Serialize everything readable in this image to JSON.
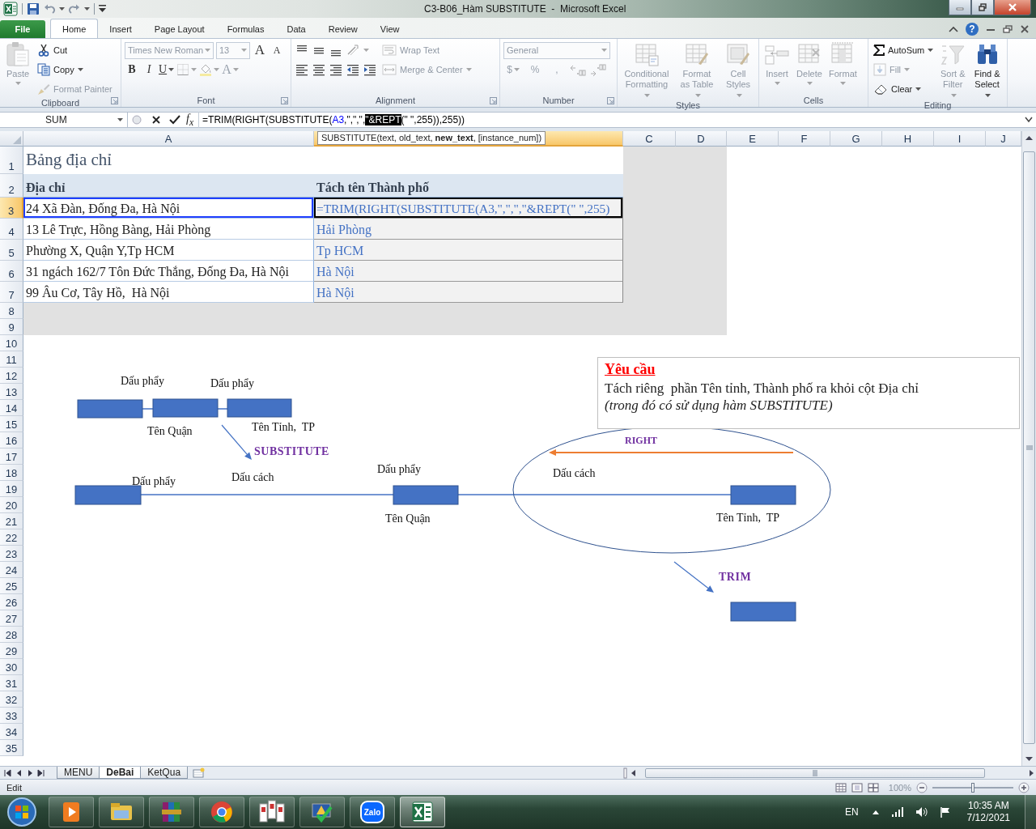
{
  "window": {
    "title": "C3-B06_Hàm SUBSTITUTE  -  Microsoft Excel"
  },
  "help": "?",
  "ribbon_tabs": [
    {
      "label": "File",
      "kind": "file",
      "selected": false
    },
    {
      "label": "Home",
      "kind": "tab",
      "selected": true
    },
    {
      "label": "Insert",
      "kind": "tab",
      "selected": false
    },
    {
      "label": "Page Layout",
      "kind": "tab",
      "selected": false
    },
    {
      "label": "Formulas",
      "kind": "tab",
      "selected": false
    },
    {
      "label": "Data",
      "kind": "tab",
      "selected": false
    },
    {
      "label": "Review",
      "kind": "tab",
      "selected": false
    },
    {
      "label": "View",
      "kind": "tab",
      "selected": false
    }
  ],
  "ribbon_groups": [
    {
      "label": "Clipboard",
      "launcher": true,
      "stacks": [
        {
          "lines": [
            {
              "items": [
                {
                  "kind": "large",
                  "lines": [
                    "Paste"
                  ],
                  "disabled": true,
                  "dropdown": true
                }
              ]
            }
          ]
        },
        {
          "lines": [
            {
              "items": [
                {
                  "kind": "small",
                  "label": "Cut",
                  "disabled": false,
                  "dropdown": false
                }
              ]
            },
            {
              "items": [
                {
                  "kind": "small",
                  "label": "Copy",
                  "disabled": false,
                  "dropdown": true
                }
              ]
            },
            {
              "items": [
                {
                  "kind": "small",
                  "label": "Format Painter",
                  "disabled": true,
                  "dropdown": false
                }
              ]
            }
          ]
        }
      ]
    },
    {
      "label": "Font",
      "launcher": true,
      "stacks": [
        {
          "lines": [
            {
              "items": [
                {
                  "kind": "field",
                  "value": "Times New Roman",
                  "disabled": true,
                  "dropdown": true
                },
                {
                  "kind": "field",
                  "value": "13",
                  "disabled": true,
                  "dropdown": true
                },
                {
                  "kind": "glyph",
                  "label": "A",
                  "disabled": false,
                  "dropdown": false
                },
                {
                  "kind": "glyph",
                  "label": "A",
                  "disabled": false,
                  "dropdown": false
                }
              ]
            },
            {
              "items": [
                {
                  "kind": "glyph",
                  "label": "B",
                  "disabled": false,
                  "dropdown": false
                },
                {
                  "kind": "glyph",
                  "label": "I",
                  "disabled": false,
                  "dropdown": false
                },
                {
                  "kind": "glyph",
                  "label": "U",
                  "disabled": false,
                  "dropdown": true
                },
                {
                  "kind": "icon",
                  "disabled": true,
                  "dropdown": true
                },
                {
                  "kind": "icon",
                  "disabled": true,
                  "dropdown": true
                },
                {
                  "kind": "glyph",
                  "label": "A",
                  "disabled": true,
                  "dropdown": true
                }
              ]
            }
          ]
        }
      ]
    },
    {
      "label": "Alignment",
      "launcher": true,
      "stacks": [
        {
          "lines": [
            {
              "items": [
                {
                  "kind": "icon",
                  "disabled": false,
                  "dropdown": false
                },
                {
                  "kind": "icon",
                  "disabled": false,
                  "dropdown": false
                },
                {
                  "kind": "icon",
                  "disabled": false,
                  "dropdown": false
                },
                {
                  "kind": "icon",
                  "disabled": true,
                  "dropdown": true
                }
              ]
            },
            {
              "items": [
                {
                  "kind": "icon",
                  "disabled": false,
                  "dropdown": false
                },
                {
                  "kind": "icon",
                  "disabled": false,
                  "dropdown": false
                },
                {
                  "kind": "icon",
                  "disabled": false,
                  "dropdown": false
                },
                {
                  "kind": "icon",
                  "disabled": false,
                  "dropdown": false
                },
                {
                  "kind": "icon",
                  "disabled": false,
                  "dropdown": false
                }
              ]
            }
          ]
        },
        {
          "lines": [
            {
              "items": [
                {
                  "kind": "small",
                  "label": "Wrap Text",
                  "disabled": true,
                  "dropdown": false
                }
              ]
            },
            {
              "items": [
                {
                  "kind": "small",
                  "label": "Merge & Center",
                  "disabled": true,
                  "dropdown": true
                }
              ]
            }
          ]
        }
      ]
    },
    {
      "label": "Number",
      "launcher": true,
      "stacks": [
        {
          "lines": [
            {
              "items": [
                {
                  "kind": "field",
                  "value": "General",
                  "disabled": true,
                  "dropdown": true
                }
              ]
            },
            {
              "items": [
                {
                  "kind": "glyph",
                  "label": "$",
                  "disabled": true,
                  "dropdown": true
                },
                {
                  "kind": "glyph",
                  "label": "%",
                  "disabled": true,
                  "dropdown": false
                },
                {
                  "kind": "glyph",
                  "label": ",",
                  "disabled": true,
                  "dropdown": false
                },
                {
                  "kind": "icon",
                  "disabled": true,
                  "dropdown": false
                },
                {
                  "kind": "icon",
                  "disabled": true,
                  "dropdown": false
                }
              ]
            }
          ]
        }
      ]
    },
    {
      "label": "Styles",
      "launcher": false,
      "stacks": [
        {
          "lines": [
            {
              "items": [
                {
                  "kind": "large",
                  "lines": [
                    "Conditional",
                    "Formatting"
                  ],
                  "disabled": true,
                  "dropdown": true
                }
              ]
            }
          ]
        },
        {
          "lines": [
            {
              "items": [
                {
                  "kind": "large",
                  "lines": [
                    "Format",
                    "as Table"
                  ],
                  "disabled": true,
                  "dropdown": true
                }
              ]
            }
          ]
        },
        {
          "lines": [
            {
              "items": [
                {
                  "kind": "large",
                  "lines": [
                    "Cell",
                    "Styles"
                  ],
                  "disabled": true,
                  "dropdown": true
                }
              ]
            }
          ]
        }
      ]
    },
    {
      "label": "Cells",
      "launcher": false,
      "stacks": [
        {
          "lines": [
            {
              "items": [
                {
                  "kind": "large",
                  "lines": [
                    "Insert"
                  ],
                  "disabled": true,
                  "dropdown": true
                }
              ]
            }
          ]
        },
        {
          "lines": [
            {
              "items": [
                {
                  "kind": "large",
                  "lines": [
                    "Delete"
                  ],
                  "disabled": true,
                  "dropdown": true
                }
              ]
            }
          ]
        },
        {
          "lines": [
            {
              "items": [
                {
                  "kind": "large",
                  "lines": [
                    "Format"
                  ],
                  "disabled": true,
                  "dropdown": true
                }
              ]
            }
          ]
        }
      ]
    },
    {
      "label": "Editing",
      "launcher": false,
      "stacks": [
        {
          "lines": [
            {
              "items": [
                {
                  "kind": "small",
                  "label": "AutoSum",
                  "disabled": false,
                  "dropdown": true
                }
              ]
            },
            {
              "items": [
                {
                  "kind": "small",
                  "label": "Fill",
                  "disabled": true,
                  "dropdown": true
                }
              ]
            },
            {
              "items": [
                {
                  "kind": "small",
                  "label": "Clear",
                  "disabled": false,
                  "dropdown": true
                }
              ]
            }
          ]
        },
        {
          "lines": [
            {
              "items": [
                {
                  "kind": "large",
                  "lines": [
                    "Sort &",
                    "Filter"
                  ],
                  "disabled": true,
                  "dropdown": true
                }
              ]
            }
          ]
        },
        {
          "lines": [
            {
              "items": [
                {
                  "kind": "large",
                  "lines": [
                    "Find &",
                    "Select"
                  ],
                  "disabled": false,
                  "dropdown": true
                }
              ]
            }
          ]
        }
      ]
    }
  ],
  "formula_bar": {
    "name_box": "SUM",
    "fx": "f$_{x}$",
    "segments": [
      {
        "text": "=TRIM(RIGHT(SUBSTITUTE(",
        "color": "#000000",
        "selected": false
      },
      {
        "text": "A3",
        "color": "#0000ff",
        "selected": false
      },
      {
        "text": ",\",\",\",",
        "color": "#000000",
        "selected": false
      },
      {
        "text": "\"&REPT",
        "selected": true
      },
      {
        "text": "(\" \",255)),255))",
        "color": "#000000",
        "selected": false
      }
    ]
  },
  "tooltip": "SUBSTITUTE(text, old_text, **new_text**, [instance_num])",
  "columns": [
    {
      "label": "A",
      "selected": false
    },
    {
      "selected": true
    },
    {
      "label": "C",
      "selected": false
    },
    {
      "label": "D",
      "selected": false
    },
    {
      "label": "E",
      "selected": false
    },
    {
      "label": "F",
      "selected": false
    },
    {
      "label": "G",
      "selected": false
    },
    {
      "label": "H",
      "selected": false
    },
    {
      "label": "I",
      "selected": false
    },
    {
      "label": "J",
      "selected": false
    }
  ],
  "rows": [
    {
      "label": "1",
      "selected": false
    },
    {
      "label": "2",
      "selected": false
    },
    {
      "label": "3",
      "selected": true
    },
    {
      "label": "4",
      "selected": false
    },
    {
      "label": "5",
      "selected": false
    },
    {
      "label": "6",
      "selected": false
    },
    {
      "label": "7",
      "selected": false
    },
    {
      "label": "8",
      "selected": false
    },
    {
      "label": "9",
      "selected": false
    },
    {
      "label": "10",
      "selected": false
    },
    {
      "label": "11",
      "selected": false
    },
    {
      "label": "12",
      "selected": false
    },
    {
      "label": "13",
      "selected": false
    },
    {
      "label": "14",
      "selected": false
    },
    {
      "label": "15",
      "selected": false
    },
    {
      "label": "16",
      "selected": false
    },
    {
      "label": "17",
      "selected": false
    },
    {
      "label": "18",
      "selected": false
    },
    {
      "label": "19",
      "selected": false
    },
    {
      "label": "20",
      "selected": false
    },
    {
      "label": "21",
      "selected": false
    },
    {
      "label": "22",
      "selected": false
    },
    {
      "label": "23",
      "selected": false
    },
    {
      "label": "24",
      "selected": false
    },
    {
      "label": "25",
      "selected": false
    },
    {
      "label": "26",
      "selected": false
    },
    {
      "label": "27",
      "selected": false
    },
    {
      "label": "28",
      "selected": false
    },
    {
      "label": "29",
      "selected": false
    },
    {
      "label": "30",
      "selected": false
    },
    {
      "label": "31",
      "selected": false
    },
    {
      "label": "32",
      "selected": false
    },
    {
      "label": "33",
      "selected": false
    },
    {
      "label": "34",
      "selected": false
    },
    {
      "label": "35",
      "selected": false
    }
  ],
  "table": [
    {
      "kind": "title",
      "cells": [
        {
          "text": "Bảng địa chỉ",
          "referenced": false,
          "active": false
        }
      ]
    },
    {
      "kind": "header",
      "cells": [
        {
          "text": "Địa chỉ",
          "referenced": false,
          "active": false
        },
        {
          "text": "Tách tên Thành phố",
          "referenced": false,
          "active": false
        }
      ]
    },
    {
      "kind": "data",
      "cells": [
        {
          "text": "24 Xã Đàn, Đống Đa, Hà Nội",
          "referenced": true,
          "active": false
        },
        {
          "text": "=TRIM(RIGHT(SUBSTITUTE(A3,\",\",\",\"&REPT(\" \",255)",
          "referenced": false,
          "active": true
        }
      ]
    },
    {
      "kind": "data",
      "cells": [
        {
          "text": "13 Lê Trực, Hồng Bàng, Hải Phòng",
          "referenced": false,
          "active": false
        },
        {
          "text": "Hải Phòng",
          "referenced": false,
          "active": false
        }
      ]
    },
    {
      "kind": "data",
      "cells": [
        {
          "text": "Phường X, Quận Y,Tp HCM",
          "referenced": false,
          "active": false
        },
        {
          "text": "Tp HCM",
          "referenced": false,
          "active": false
        }
      ]
    },
    {
      "kind": "data",
      "cells": [
        {
          "text": "31 ngách 162/7 Tôn Đức Thắng, Đống Đa, Hà Nội",
          "referenced": false,
          "active": false
        },
        {
          "text": "Hà Nội",
          "referenced": false,
          "active": false
        }
      ]
    },
    {
      "kind": "data",
      "cells": [
        {
          "text": "99 Âu Cơ, Tây Hồ,  Hà Nội",
          "referenced": false,
          "active": false
        },
        {
          "text": "Hà Nội",
          "referenced": false,
          "active": false
        }
      ]
    }
  ],
  "note": {
    "title": "Yêu cầu",
    "text": "Tách riêng  phần Tên tỉnh, Thành phố ra khỏi cột Địa chỉ",
    "hint": "(trong đó có sử dụng hàm SUBSTITUTE)"
  },
  "diagram_labels": [
    {
      "text": "Dấu phẩy",
      "kind": "label"
    },
    {
      "text": "Dấu phẩy",
      "kind": "label"
    },
    {
      "text": "Tên Quận",
      "kind": "label"
    },
    {
      "text": "Tên Tỉnh,  TP",
      "kind": "label"
    },
    {
      "text": "SUBSTITUTE",
      "kind": "function"
    },
    {
      "text": "Dấu phẩy",
      "kind": "label"
    },
    {
      "text": "Dấu cách",
      "kind": "label"
    },
    {
      "text": "Dấu phẩy",
      "kind": "label"
    },
    {
      "text": "Tên Quận",
      "kind": "label"
    },
    {
      "text": "Dấu cách",
      "kind": "label"
    },
    {
      "text": "Tên Tỉnh,  TP",
      "kind": "label"
    },
    {
      "text": "RIGHT",
      "kind": "function"
    },
    {
      "text": "TRIM",
      "kind": "function"
    }
  ],
  "sheet_tabs": [
    {
      "label": "MENU",
      "selected": false
    },
    {
      "label": "DeBai",
      "selected": true
    },
    {
      "label": "KetQua",
      "selected": false
    }
  ],
  "status_bar": {
    "mode": "Edit",
    "zoom": "100%",
    "zoom_slider": {
      "level": 0.5
    }
  },
  "taskbar": {
    "apps": [
      {
        "selected": false
      },
      {
        "selected": false
      },
      {
        "selected": false
      },
      {
        "selected": false
      },
      {
        "selected": false
      },
      {
        "selected": false
      },
      {
        "label": "Zalo",
        "selected": false
      },
      {
        "selected": true
      }
    ],
    "language": "EN",
    "time": "10:35 AM",
    "date": "7/12/2021"
  }
}
